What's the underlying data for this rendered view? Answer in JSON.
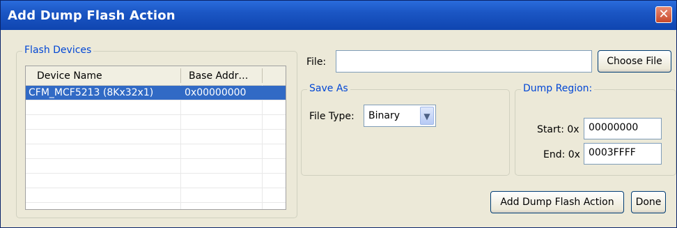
{
  "window": {
    "title": "Add Dump Flash Action",
    "close_glyph": "✕"
  },
  "flash_devices": {
    "legend": "Flash Devices",
    "columns": [
      "Device Name",
      "Base Addr…"
    ],
    "rows": [
      {
        "name": "CFM_MCF5213 (8Kx32x1)",
        "base_addr": "0x00000000",
        "selected": true
      }
    ]
  },
  "file": {
    "label": "File:",
    "value": "",
    "choose_button": "Choose File"
  },
  "save_as": {
    "legend": "Save As",
    "file_type_label": "File Type:",
    "file_type_value": "Binary",
    "dropdown_glyph": "▼"
  },
  "dump_region": {
    "legend": "Dump Region:",
    "start_label": "Start: 0x",
    "start_value": "00000000",
    "end_label": "End: 0x",
    "end_value": "0003FFFF"
  },
  "buttons": {
    "add": "Add Dump Flash Action",
    "done": "Done"
  },
  "colors": {
    "title_bar": "#1b56c4",
    "selection": "#316ac5",
    "legend_text": "#0046d5",
    "dialog_bg": "#ece9d8"
  }
}
